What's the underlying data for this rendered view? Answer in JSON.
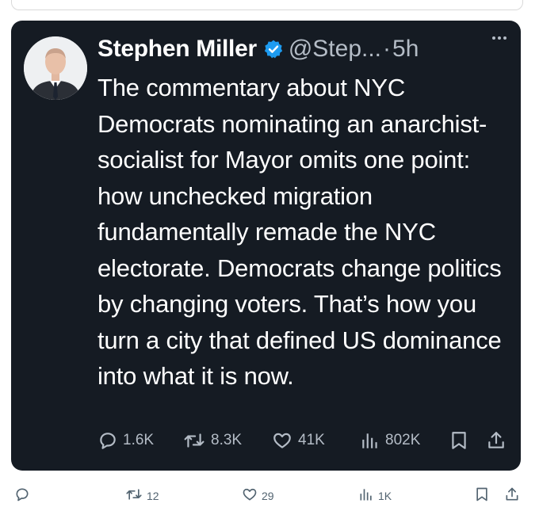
{
  "tweet": {
    "author_name": "Stephen Miller",
    "handle": "@Step...",
    "separator": "·",
    "time": "5h",
    "text": "The commentary about NYC Democrats nominating an anarchist-socialist for Mayor omits one point: how unchecked migration fundamentally remade the NYC electorate. Democrats change politics by changing voters. That’s how you turn a city that defined US dominance into what it is now.",
    "stats": {
      "replies": "1.6K",
      "reposts": "8.3K",
      "likes": "41K",
      "views": "802K"
    }
  },
  "outer_post": {
    "stats": {
      "replies": "",
      "reposts": "12",
      "likes": "29",
      "views": "1K"
    }
  },
  "colors": {
    "card_background": "#151b23",
    "muted_text": "#b4bcc6",
    "verified_badge": "#1d9bf0",
    "outer_icon": "#536471"
  },
  "icons": [
    "verified-icon",
    "more-icon",
    "reply-icon",
    "repost-icon",
    "like-icon",
    "views-icon",
    "bookmark-icon",
    "share-icon"
  ]
}
